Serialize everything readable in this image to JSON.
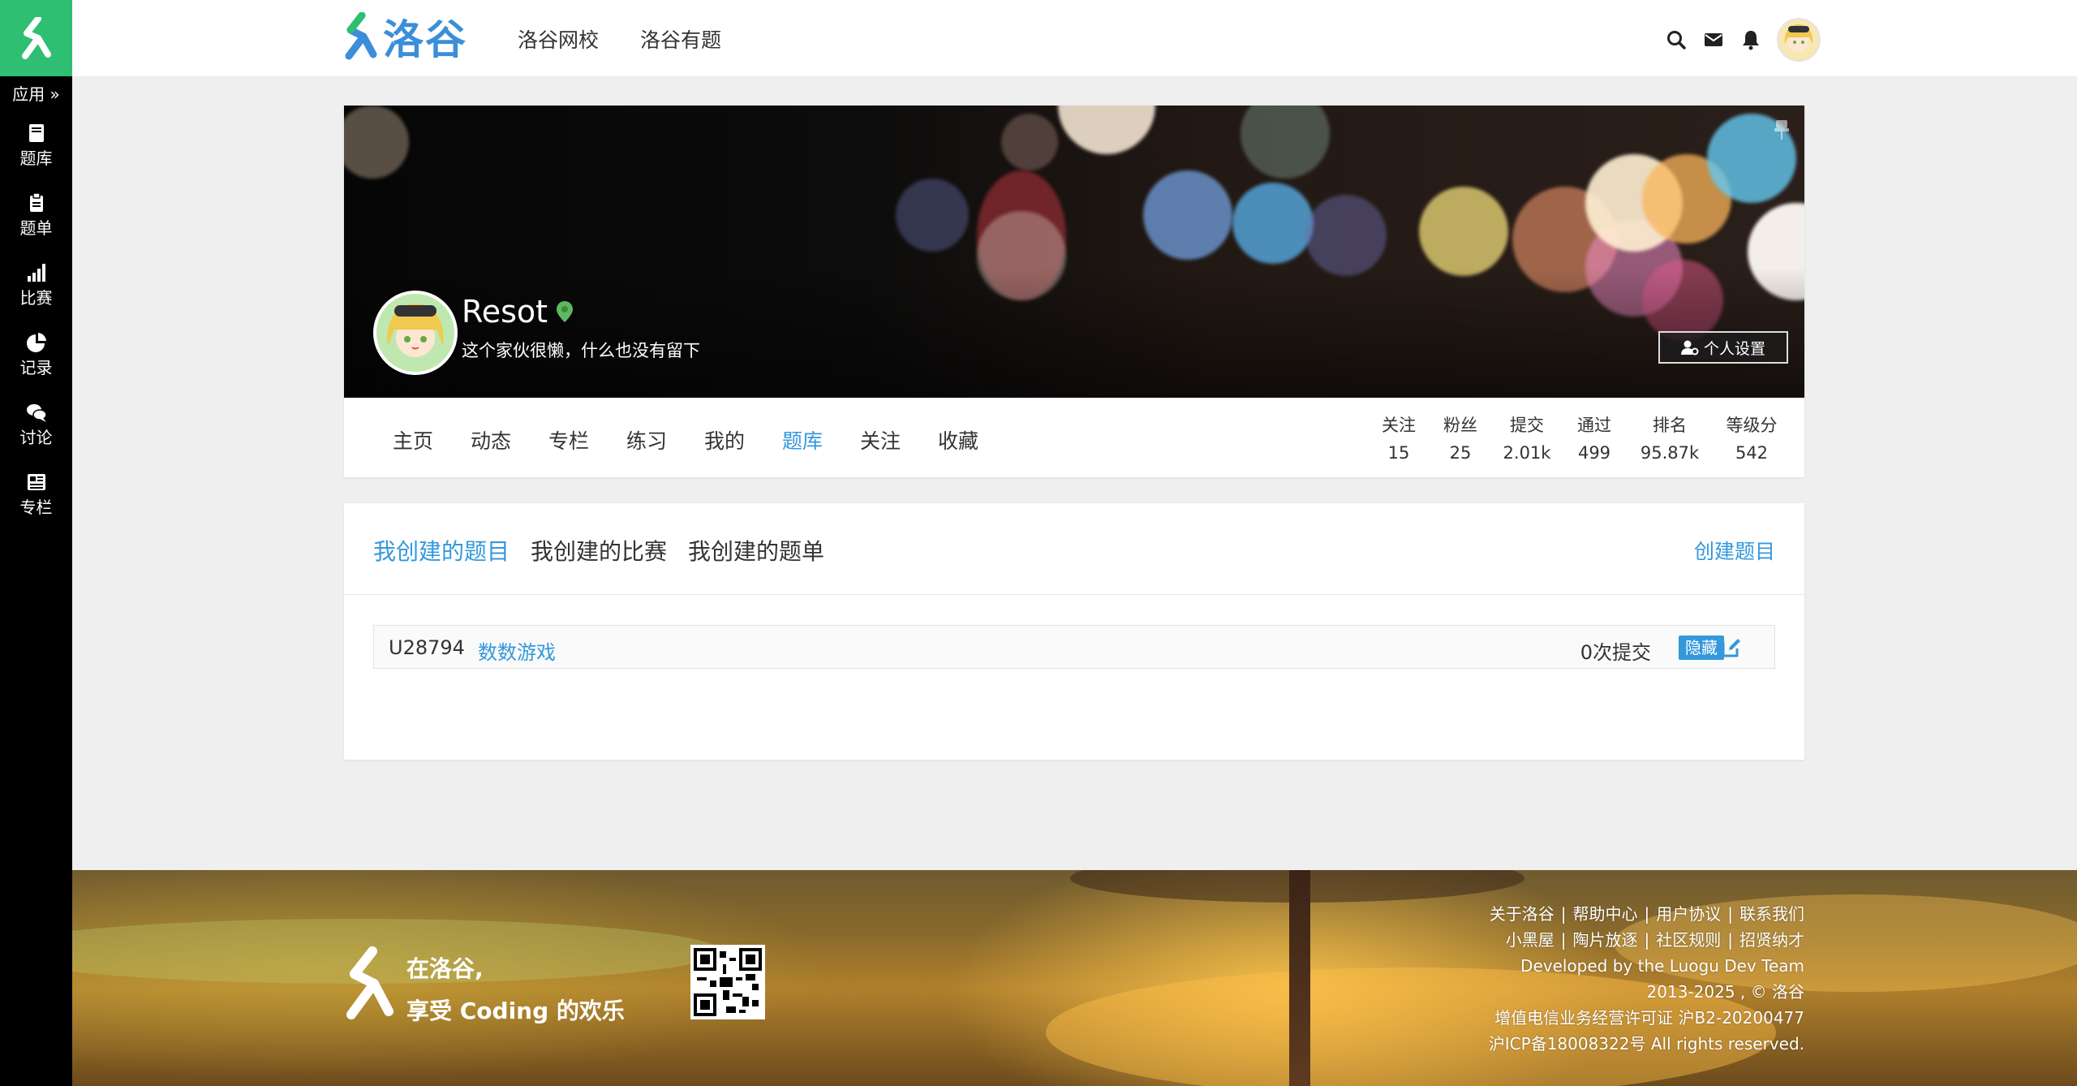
{
  "sidebar": {
    "apps_label": "应用",
    "items": [
      {
        "label": "题库",
        "icon": "book-icon"
      },
      {
        "label": "题单",
        "icon": "clipboard-icon"
      },
      {
        "label": "比赛",
        "icon": "bar-chart-icon"
      },
      {
        "label": "记录",
        "icon": "pie-chart-icon"
      },
      {
        "label": "讨论",
        "icon": "comments-icon"
      },
      {
        "label": "专栏",
        "icon": "newspaper-icon"
      }
    ]
  },
  "header": {
    "brand": "洛谷",
    "nav": [
      "洛谷网校",
      "洛谷有题"
    ]
  },
  "profile": {
    "name": "Resot",
    "bio": "这个家伙很懒，什么也没有留下",
    "settings_label": "个人设置",
    "tabs": [
      "主页",
      "动态",
      "专栏",
      "练习",
      "我的",
      "题库",
      "关注",
      "收藏"
    ],
    "active_tab": "题库",
    "stats": [
      {
        "label": "关注",
        "value": "15"
      },
      {
        "label": "粉丝",
        "value": "25"
      },
      {
        "label": "提交",
        "value": "2.01k"
      },
      {
        "label": "通过",
        "value": "499"
      },
      {
        "label": "排名",
        "value": "95.87k"
      },
      {
        "label": "等级分",
        "value": "542"
      }
    ]
  },
  "problems": {
    "tabs": [
      "我创建的题目",
      "我创建的比赛",
      "我创建的题单"
    ],
    "active_tab": "我创建的题目",
    "create_label": "创建题目",
    "rows": [
      {
        "pid": "U28794",
        "title": "数数游戏",
        "submits": "0次提交",
        "badge": "隐藏"
      }
    ]
  },
  "footer": {
    "slogan_line1": "在洛谷,",
    "slogan_line2": "享受 Coding 的欢乐",
    "links_row1": [
      "关于洛谷",
      "帮助中心",
      "用户协议",
      "联系我们"
    ],
    "links_row2": [
      "小黑屋",
      "陶片放逐",
      "社区规则",
      "招贤纳才"
    ],
    "credit": "Developed by the Luogu Dev Team",
    "copyright": "2013-2025 , © 洛谷",
    "license": "增值电信业务经营许可证 沪B2-20200477",
    "icp": "沪ICP备18008322号 All rights reserved."
  },
  "colors": {
    "accent": "#3498db",
    "brand_green": "#2fbf72",
    "sidebar_bg": "#000000"
  }
}
